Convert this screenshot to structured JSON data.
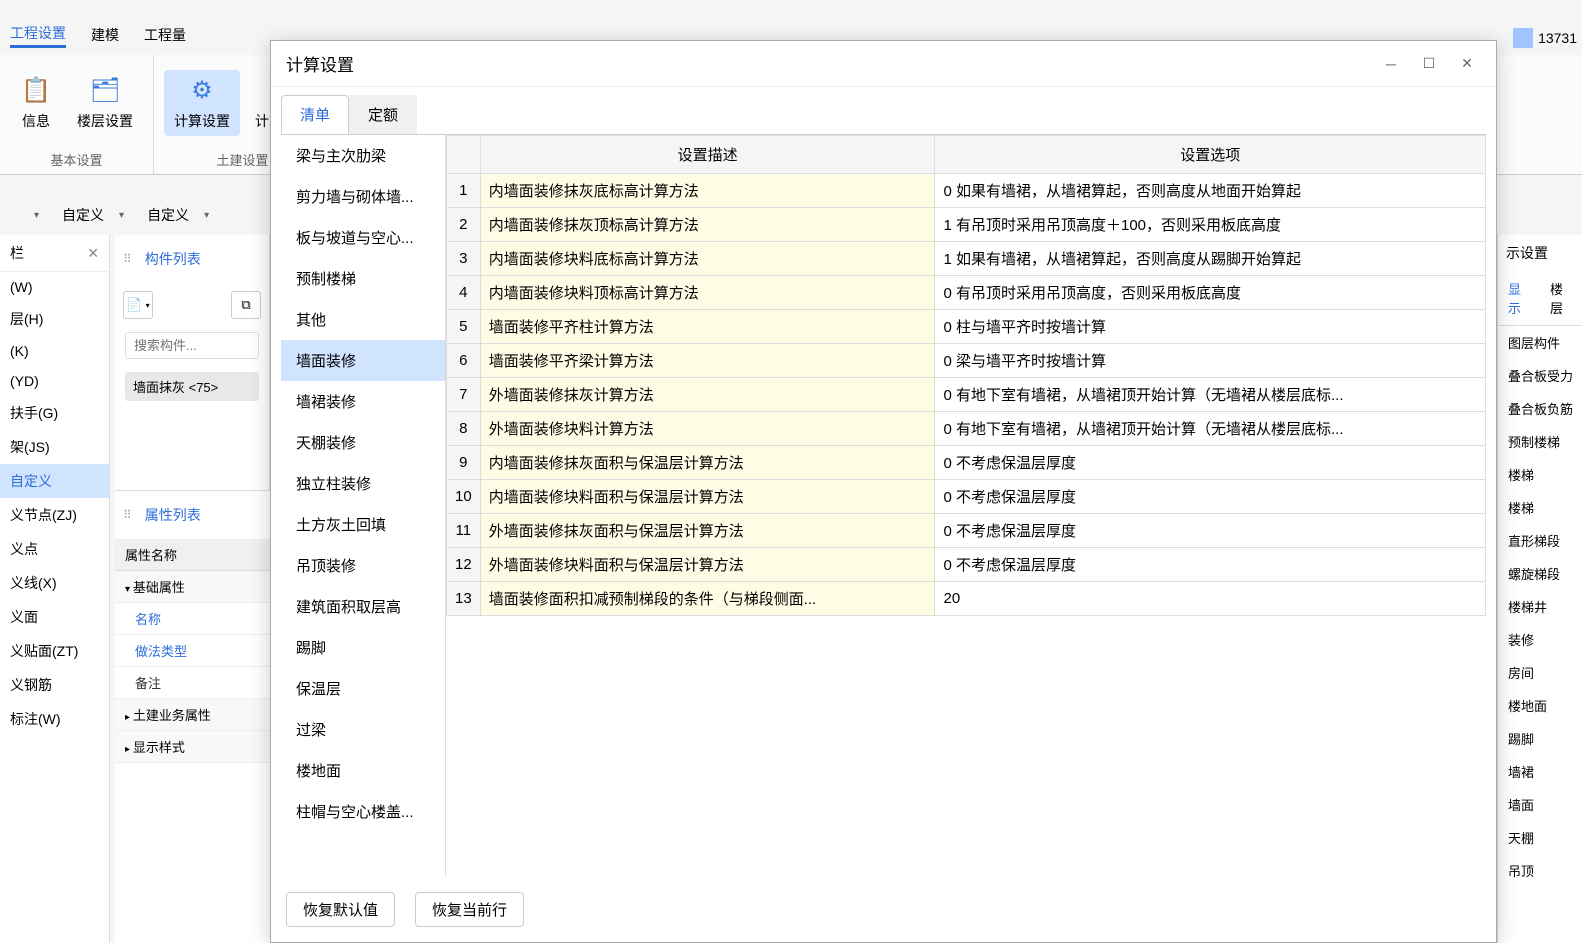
{
  "user_id": "13731",
  "main_tabs": {
    "t1": "工程设置",
    "t2": "建模",
    "t3": "工程量"
  },
  "ribbon": {
    "group1_label": "基本设置",
    "group2_label": "土建设置",
    "btn_info": "信息",
    "btn_floor": "楼层设置",
    "btn_calc": "计算设置",
    "btn_rule": "计算规则"
  },
  "dropdowns": {
    "d1": "",
    "d2": "自定义",
    "d3": "自定义"
  },
  "left_tree": {
    "header": "栏",
    "items": [
      "(W)",
      "层(H)",
      "(K)",
      "(YD)",
      "扶手(G)",
      "架(JS)",
      "自定义",
      "义节点(ZJ)",
      "义点",
      "义线(X)",
      "义面",
      "义贴面(ZT)",
      "义钢筋",
      "标注(W)"
    ],
    "active_index": 6
  },
  "component_list": {
    "tab": "构件列表",
    "search_placeholder": "搜索构件...",
    "item": "墙面抹灰 <75>"
  },
  "property_list": {
    "tab": "属性列表",
    "header": "属性名称",
    "group1": "基础属性",
    "rows": [
      "名称",
      "做法类型",
      "备注"
    ],
    "group2": "土建业务属性",
    "group3": "显示样式"
  },
  "right_panel": {
    "header_tab": "示设置",
    "tab1": "显示",
    "tab2": "楼层",
    "items": [
      "图层构件",
      "叠合板受力",
      "叠合板负筋",
      "预制楼梯",
      "楼梯",
      "楼梯",
      "直形梯段",
      "螺旋梯段",
      "楼梯井",
      "装修",
      "房间",
      "楼地面",
      "踢脚",
      "墙裙",
      "墙面",
      "天棚",
      "吊顶"
    ]
  },
  "dialog": {
    "title": "计算设置",
    "tab1": "清单",
    "tab2": "定额",
    "categories": [
      "梁与主次肋梁",
      "剪力墙与砌体墙...",
      "板与坡道与空心...",
      "预制楼梯",
      "其他",
      "墙面装修",
      "墙裙装修",
      "天棚装修",
      "独立柱装修",
      "土方灰土回填",
      "吊顶装修",
      "建筑面积取层高",
      "踢脚",
      "保温层",
      "过梁",
      "楼地面",
      "柱帽与空心楼盖..."
    ],
    "active_category": 5,
    "col1": "设置描述",
    "col2": "设置选项",
    "rows": [
      {
        "n": "1",
        "d": "内墙面装修抹灰底标高计算方法",
        "v": "0 如果有墙裙，从墙裙算起，否则高度从地面开始算起"
      },
      {
        "n": "2",
        "d": "内墙面装修抹灰顶标高计算方法",
        "v": "1 有吊顶时采用吊顶高度＋100，否则采用板底高度"
      },
      {
        "n": "3",
        "d": "内墙面装修块料底标高计算方法",
        "v": "1 如果有墙裙，从墙裙算起，否则高度从踢脚开始算起"
      },
      {
        "n": "4",
        "d": "内墙面装修块料顶标高计算方法",
        "v": "0 有吊顶时采用吊顶高度，否则采用板底高度"
      },
      {
        "n": "5",
        "d": "墙面装修平齐柱计算方法",
        "v": "0 柱与墙平齐时按墙计算"
      },
      {
        "n": "6",
        "d": "墙面装修平齐梁计算方法",
        "v": "0 梁与墙平齐时按墙计算"
      },
      {
        "n": "7",
        "d": "外墙面装修抹灰计算方法",
        "v": "0 有地下室有墙裙，从墙裙顶开始计算（无墙裙从楼层底标..."
      },
      {
        "n": "8",
        "d": "外墙面装修块料计算方法",
        "v": "0 有地下室有墙裙，从墙裙顶开始计算（无墙裙从楼层底标..."
      },
      {
        "n": "9",
        "d": "内墙面装修抹灰面积与保温层计算方法",
        "v": "0 不考虑保温层厚度"
      },
      {
        "n": "10",
        "d": "内墙面装修块料面积与保温层计算方法",
        "v": "0 不考虑保温层厚度"
      },
      {
        "n": "11",
        "d": "外墙面装修抹灰面积与保温层计算方法",
        "v": "0 不考虑保温层厚度"
      },
      {
        "n": "12",
        "d": "外墙面装修块料面积与保温层计算方法",
        "v": "0 不考虑保温层厚度"
      },
      {
        "n": "13",
        "d": "墙面装修面积扣减预制梯段的条件（与梯段侧面...",
        "v": "20"
      }
    ],
    "footer_btn1": "恢复默认值",
    "footer_btn2": "恢复当前行"
  }
}
